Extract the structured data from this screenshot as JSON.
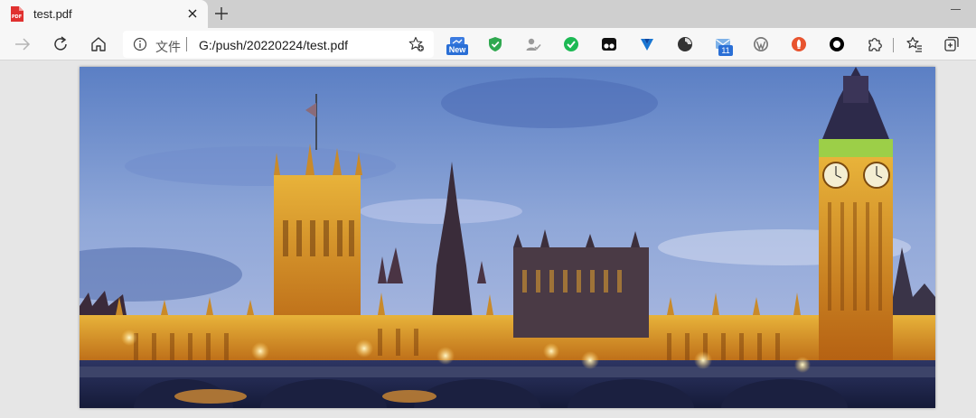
{
  "tab": {
    "title": "test.pdf",
    "favicon": "pdf-file-icon",
    "close_icon": "close-icon"
  },
  "window": {
    "new_tab_icon": "plus-icon",
    "minimize_icon": "minimize-icon"
  },
  "toolbar": {
    "forward_icon": "forward-arrow-icon",
    "refresh_icon": "refresh-icon",
    "home_icon": "home-icon",
    "address": {
      "info_icon": "info-icon",
      "scheme_label": "文件",
      "url": "G:/push/20220224/test.pdf",
      "favorite_icon": "add-favorite-icon"
    },
    "extensions": [
      {
        "name": "new-extension-icon",
        "badge": "New"
      },
      {
        "name": "shield-extension-icon"
      },
      {
        "name": "user-check-extension-icon"
      },
      {
        "name": "green-check-extension-icon"
      },
      {
        "name": "tampermonkey-extension-icon"
      },
      {
        "name": "v-extension-icon"
      },
      {
        "name": "circle-extension-icon"
      },
      {
        "name": "mail-extension-icon",
        "badge": "11"
      },
      {
        "name": "wordpress-extension-icon"
      },
      {
        "name": "rocket-extension-icon"
      },
      {
        "name": "ring-extension-icon"
      },
      {
        "name": "puzzle-extensions-icon"
      }
    ],
    "favorites_icon": "favorites-list-icon",
    "collections_icon": "collections-icon"
  },
  "document": {
    "page_image": "london-parliament-big-ben-night-photo"
  }
}
